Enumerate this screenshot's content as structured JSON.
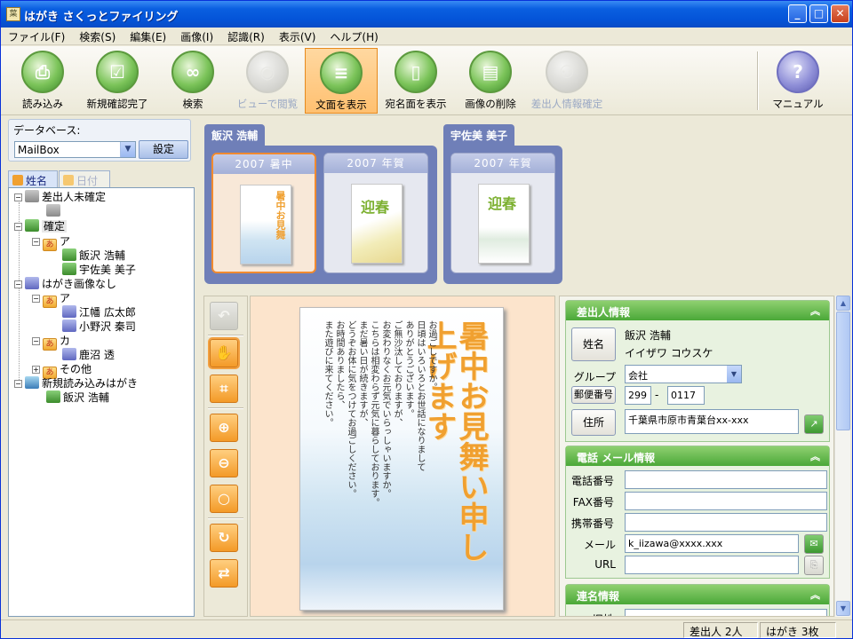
{
  "window": {
    "title": "はがき さくっとファイリング",
    "app_icon": "葉"
  },
  "titlebar_buttons": {
    "minimize": "_",
    "maximize": "□",
    "close": "✕"
  },
  "menu": [
    "ファイル(F)",
    "検索(S)",
    "編集(E)",
    "画像(I)",
    "認識(R)",
    "表示(V)",
    "ヘルプ(H)"
  ],
  "toolbar": {
    "items": [
      {
        "label": "読み込み",
        "icon": "scanner-icon",
        "glyph": "⎙",
        "enabled": true
      },
      {
        "label": "新規確認完了",
        "icon": "confirm-icon",
        "glyph": "☑",
        "enabled": true
      },
      {
        "label": "検索",
        "icon": "binoculars-icon",
        "glyph": "∞",
        "enabled": true
      },
      {
        "label": "ビューで閲覧",
        "icon": "view-icon",
        "glyph": "◉",
        "enabled": false
      },
      {
        "label": "文面を表示",
        "icon": "text-side-icon",
        "glyph": "≡",
        "enabled": true,
        "active": true
      },
      {
        "label": "宛名面を表示",
        "icon": "address-side-icon",
        "glyph": "▯",
        "enabled": true
      },
      {
        "label": "画像の削除",
        "icon": "delete-image-icon",
        "glyph": "▤",
        "enabled": true
      },
      {
        "label": "差出人情報確定",
        "icon": "sender-confirm-icon",
        "glyph": "⚇",
        "enabled": false
      }
    ],
    "manual": {
      "label": "マニュアル",
      "icon": "manual-icon",
      "glyph": "?"
    }
  },
  "database": {
    "label": "データベース:",
    "value": "MailBox",
    "set_button": "設定"
  },
  "left_tabs": {
    "name_tab": "姓名",
    "date_tab": "日付"
  },
  "tree": [
    {
      "text": "差出人未確定",
      "level": 0,
      "icon": "gray",
      "expander": "−"
    },
    {
      "text": "",
      "level": 1,
      "icon": "gray"
    },
    {
      "text": "確定",
      "level": 0,
      "icon": "green",
      "expander": "−",
      "selected": true
    },
    {
      "text": "ア",
      "level": 1,
      "icon": "folder",
      "expander": "−"
    },
    {
      "text": "飯沢 浩輔",
      "level": 2,
      "icon": "green"
    },
    {
      "text": "宇佐美 美子",
      "level": 2,
      "icon": "green"
    },
    {
      "text": "はがき画像なし",
      "level": 0,
      "icon": "blue",
      "expander": "−"
    },
    {
      "text": "ア",
      "level": 1,
      "icon": "folder",
      "expander": "−"
    },
    {
      "text": "江幡 広太郎",
      "level": 2,
      "icon": "blue"
    },
    {
      "text": "小野沢 秦司",
      "level": 2,
      "icon": "blue"
    },
    {
      "text": "カ",
      "level": 1,
      "icon": "folder",
      "expander": "−"
    },
    {
      "text": "鹿沼 透",
      "level": 2,
      "icon": "blue"
    },
    {
      "text": "その他",
      "level": 1,
      "icon": "folder",
      "expander": "+"
    },
    {
      "text": "新規読み込みはがき",
      "level": 0,
      "icon": "cyan",
      "expander": "−"
    },
    {
      "text": "飯沢 浩輔",
      "level": 1,
      "icon": "green"
    }
  ],
  "preview_groups": [
    {
      "name": "飯沢 浩輔",
      "cards": [
        {
          "label": "2007 暑中",
          "selected": true
        },
        {
          "label": "2007 年賀"
        }
      ]
    },
    {
      "name": "宇佐美 美子",
      "cards": [
        {
          "label": "2007 年賀"
        }
      ]
    }
  ],
  "thumb_text": {
    "summer_title": "暑中お見舞",
    "new_year": "迎春"
  },
  "postcard": {
    "title": "暑中お見舞い申し上げます",
    "body_lines": [
      "お過ごしですか。",
      "日頃はいろいろとお世話になりまして",
      "ありがとうございます。",
      "ご無沙汰しておりますが、",
      "お変わりなくお元気でいらっしゃいますか。",
      "こちらは相変わらず元気に暮らしております。",
      "まだ暑い日が続きますが、",
      "どうぞお体に気をつけてお過ごしください。",
      "お時間ありましたら、",
      "また遊びに来てください。"
    ]
  },
  "sender": {
    "header": "差出人情報",
    "name_button": "姓名",
    "name": "飯沢 浩輔",
    "kana": "イイザワ コウスケ",
    "group_label": "グループ",
    "group_value": "会社",
    "zip_button": "郵便番号",
    "zip1": "299",
    "zip_sep": "-",
    "zip2": "0117",
    "address_button": "住所",
    "address": "千葉県市原市青葉台xx-xxx"
  },
  "contact": {
    "header": "電話 メール情報",
    "phone_label": "電話番号",
    "phone": "",
    "fax_label": "FAX番号",
    "fax": "",
    "mobile_label": "携帯番号",
    "mobile": "",
    "mail_label": "メール",
    "mail": "k_iizawa@xxxx.xxx",
    "url_label": "URL",
    "url": ""
  },
  "joint": {
    "header": "連名情報",
    "first_label": "旧姓"
  },
  "status": {
    "senders": "差出人 2人",
    "cards": "はがき 3枚"
  },
  "colors": {
    "accent_orange": "#f08a30",
    "section_green": "#4aa838",
    "group_blue": "#6f7fb8"
  }
}
